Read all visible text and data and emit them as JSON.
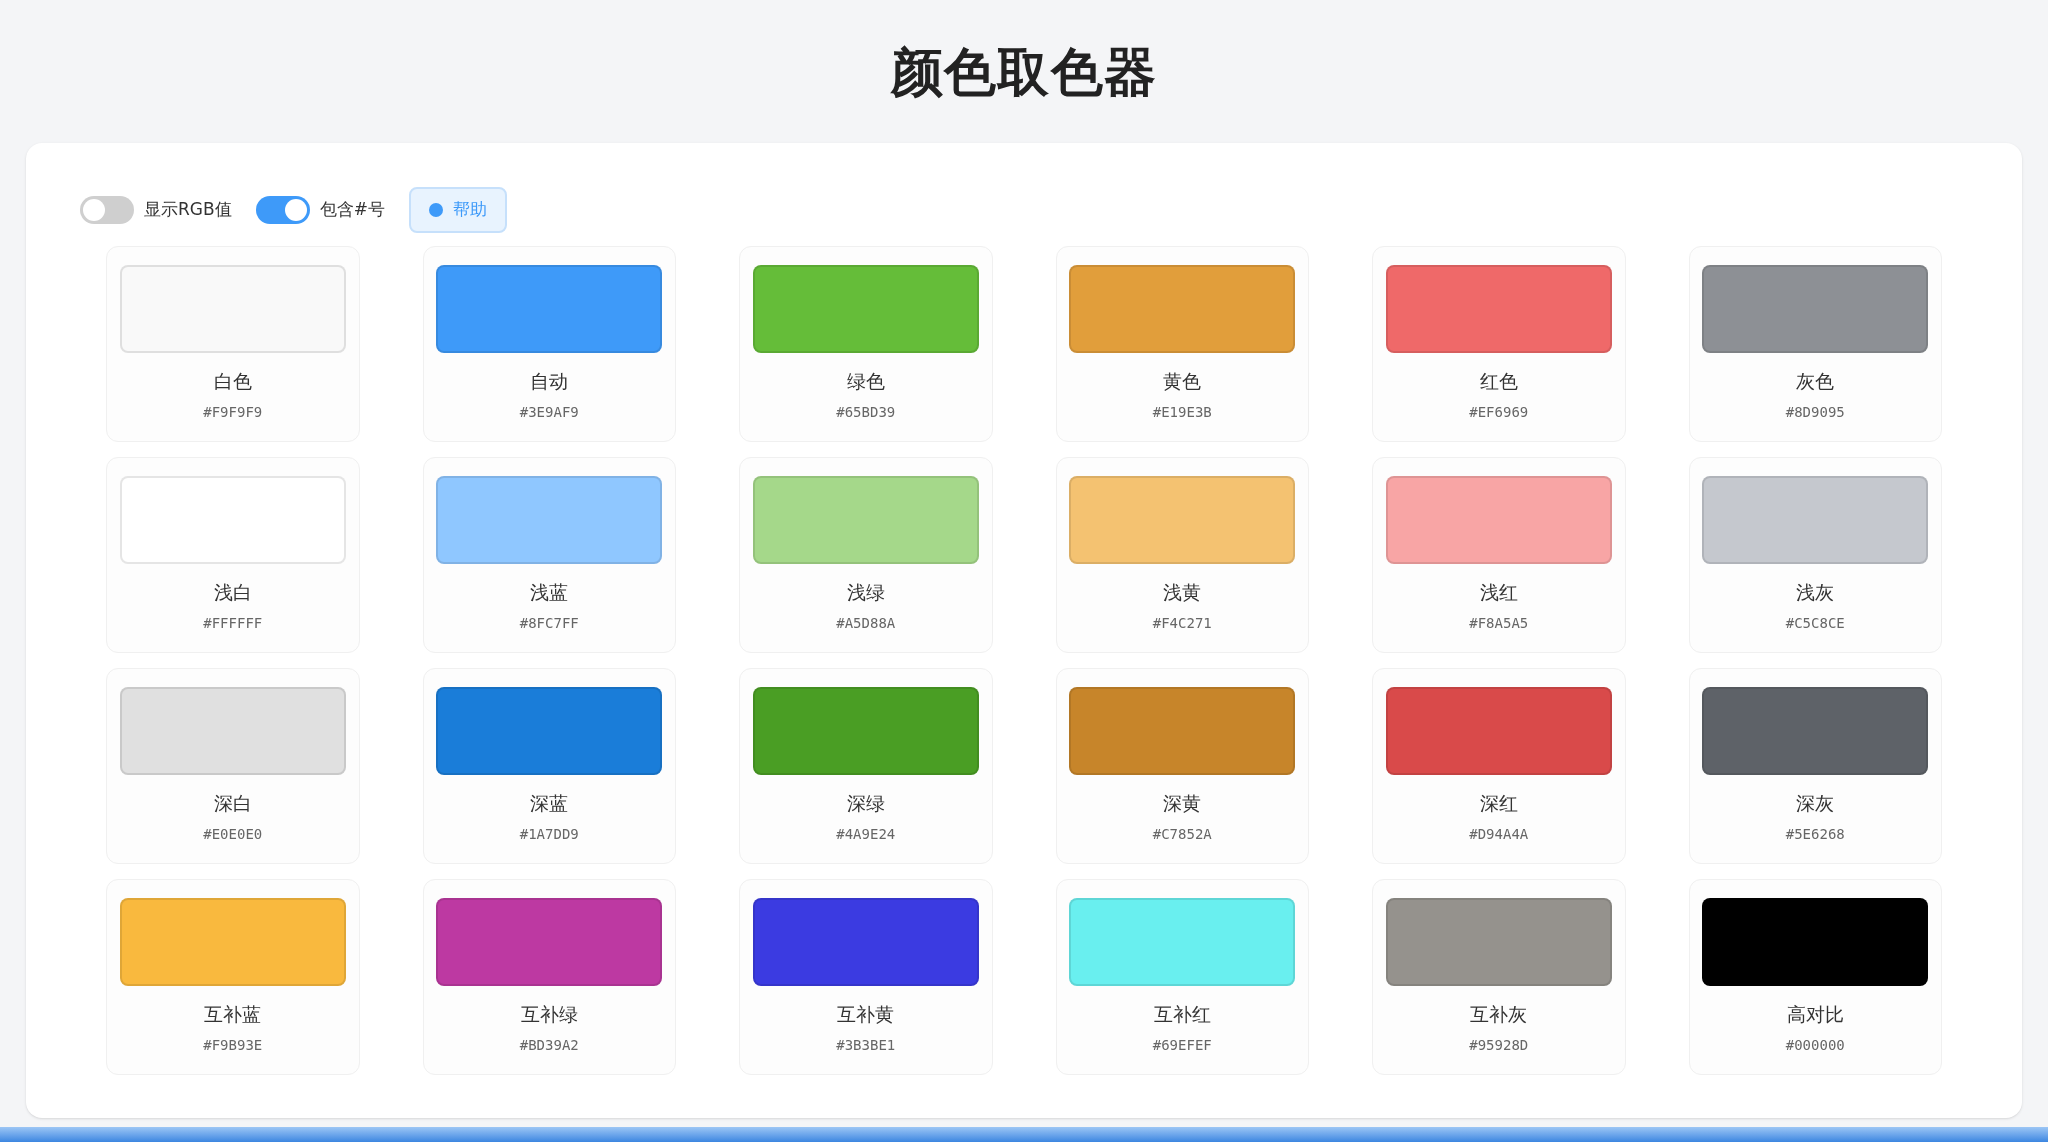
{
  "title": "颜色取色器",
  "toolbar": {
    "toggles": [
      {
        "label": "显示RGB值",
        "on": false
      },
      {
        "label": "包含#号",
        "on": true
      }
    ],
    "help_button": {
      "label": "帮助"
    }
  },
  "swatches": [
    {
      "name": "白色",
      "hex": "#F9F9F9",
      "color": "#f9f9f9"
    },
    {
      "name": "自动",
      "hex": "#3E9AF9",
      "color": "#3e9af9"
    },
    {
      "name": "绿色",
      "hex": "#65BD39",
      "color": "#65bd39"
    },
    {
      "name": "黄色",
      "hex": "#E19E3B",
      "color": "#e19e3b"
    },
    {
      "name": "红色",
      "hex": "#EF6969",
      "color": "#ef6969"
    },
    {
      "name": "灰色",
      "hex": "#8D9095",
      "color": "#8d9095"
    },
    {
      "name": "浅白",
      "hex": "#FFFFFF",
      "color": "#ffffff"
    },
    {
      "name": "浅蓝",
      "hex": "#8FC7FF",
      "color": "#8fc7ff"
    },
    {
      "name": "浅绿",
      "hex": "#A5D88A",
      "color": "#a5d88a"
    },
    {
      "name": "浅黄",
      "hex": "#F4C271",
      "color": "#f4c271"
    },
    {
      "name": "浅红",
      "hex": "#F8A5A5",
      "color": "#f8a5a5"
    },
    {
      "name": "浅灰",
      "hex": "#C5C8CE",
      "color": "#c5c8ce"
    },
    {
      "name": "深白",
      "hex": "#E0E0E0",
      "color": "#e0e0e0"
    },
    {
      "name": "深蓝",
      "hex": "#1A7DD9",
      "color": "#1a7dd9"
    },
    {
      "name": "深绿",
      "hex": "#4A9E24",
      "color": "#4a9e24"
    },
    {
      "name": "深黄",
      "hex": "#C7852A",
      "color": "#c7852a"
    },
    {
      "name": "深红",
      "hex": "#D94A4A",
      "color": "#d94a4a"
    },
    {
      "name": "深灰",
      "hex": "#5E6268",
      "color": "#5e6268"
    },
    {
      "name": "互补蓝",
      "hex": "#F9B93E",
      "color": "#f9b93e"
    },
    {
      "name": "互补绿",
      "hex": "#BD39A2",
      "color": "#bd39a2"
    },
    {
      "name": "互补黄",
      "hex": "#3B3BE1",
      "color": "#3b3be1"
    },
    {
      "name": "互补红",
      "hex": "#69EFEF",
      "color": "#69efef"
    },
    {
      "name": "互补灰",
      "hex": "#95928D",
      "color": "#95928d"
    },
    {
      "name": "高对比",
      "hex": "#000000",
      "color": "#000000"
    }
  ]
}
